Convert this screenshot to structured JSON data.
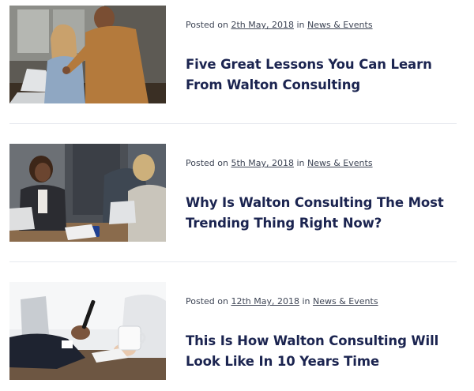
{
  "posts": [
    {
      "image": "office-meeting-woman-and-colleague-at-laptop",
      "meta_prefix": "Posted on",
      "date": "2th May, 2018",
      "meta_in": "in",
      "category": "News & Events",
      "title": "Five Great Lessons You Can Learn From Walton Consulting"
    },
    {
      "image": "business-women-at-conference-table",
      "meta_prefix": "Posted on",
      "date": "5th May, 2018",
      "meta_in": "in",
      "category": "News & Events",
      "title": "Why Is Walton Consulting The Most Trending Thing Right Now?"
    },
    {
      "image": "business-people-with-smartphone-and-coffee",
      "meta_prefix": "Posted on",
      "date": "12th May, 2018",
      "meta_in": "in",
      "category": "News & Events",
      "title": "This Is How Walton Consulting Will Look Like In 10 Years Time"
    }
  ],
  "colors": {
    "title": "#1b2450",
    "meta": "#3f4656",
    "divider": "#e6e9ee"
  }
}
